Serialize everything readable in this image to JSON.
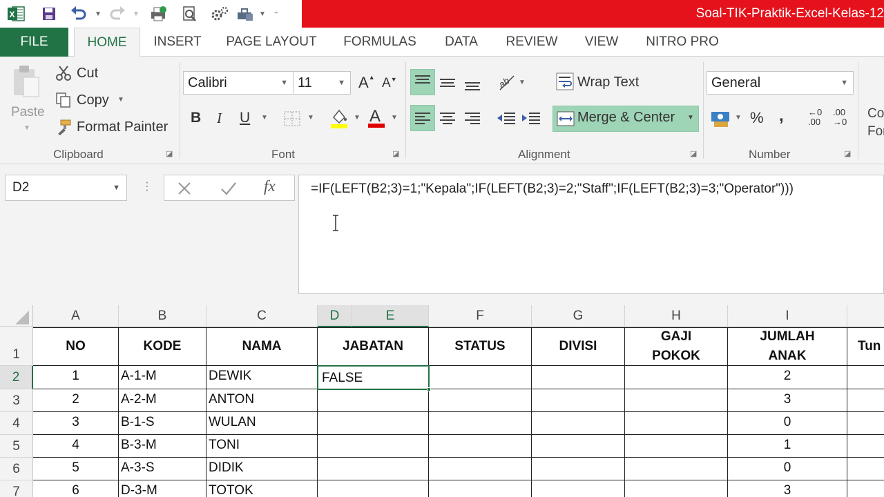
{
  "window": {
    "title": "Soal-TIK-Praktik-Excel-Kelas-12"
  },
  "tabs": [
    "FILE",
    "HOME",
    "INSERT",
    "PAGE LAYOUT",
    "FORMULAS",
    "DATA",
    "REVIEW",
    "VIEW",
    "NITRO PRO"
  ],
  "clipboard": {
    "paste": "Paste",
    "cut": "Cut",
    "copy": "Copy",
    "format_painter": "Format Painter",
    "label": "Clipboard"
  },
  "font": {
    "name": "Calibri",
    "size": "11",
    "label": "Font",
    "bold": "B",
    "italic": "I",
    "underline": "U",
    "grow": "A",
    "shrink": "A",
    "color_letter": "A"
  },
  "alignment": {
    "wrap_text": "Wrap Text",
    "merge_center": "Merge & Center",
    "label": "Alignment"
  },
  "number": {
    "format": "General",
    "percent": "%",
    "comma": ",",
    "label": "Number",
    "inc_decimal_top": "←0",
    "inc_decimal_bottom": ".00",
    "dec_decimal_top": ".00",
    "dec_decimal_bottom": "→0"
  },
  "styles": {
    "line1": "Co",
    "line2": "For"
  },
  "formula_bar": {
    "name_box": "D2",
    "fx": "fx",
    "formula": "=IF(LEFT(B2;3)=1;\"Kepala\";IF(LEFT(B2;3)=2;\"Staff\";IF(LEFT(B2;3)=3;\"Operator\")))"
  },
  "grid": {
    "columns": [
      "A",
      "B",
      "C",
      "D",
      "E",
      "F",
      "G",
      "H",
      "I"
    ],
    "rows": [
      "1",
      "2",
      "3",
      "4",
      "5",
      "6",
      "7"
    ],
    "headers": {
      "no": "NO",
      "kode": "KODE",
      "nama": "NAMA",
      "jabatan": "JABATAN",
      "status": "STATUS",
      "divisi": "DIVISI",
      "gaji": "GAJI POKOK",
      "jumlah": "JUMLAH ANAK",
      "tun": "Tun"
    },
    "data": [
      {
        "no": "1",
        "kode": "A-1-M",
        "nama": "DEWIK",
        "jabatan": "FALSE",
        "anak": "2"
      },
      {
        "no": "2",
        "kode": "A-2-M",
        "nama": "ANTON",
        "jabatan": "",
        "anak": "3"
      },
      {
        "no": "3",
        "kode": "B-1-S",
        "nama": "WULAN",
        "jabatan": "",
        "anak": "0"
      },
      {
        "no": "4",
        "kode": "B-3-M",
        "nama": "TONI",
        "jabatan": "",
        "anak": "1"
      },
      {
        "no": "5",
        "kode": "A-3-S",
        "nama": "DIDIK",
        "jabatan": "",
        "anak": "0"
      },
      {
        "no": "6",
        "kode": "D-3-M",
        "nama": "TOTOK",
        "jabatan": "",
        "anak": "3"
      }
    ]
  },
  "colors": {
    "excel_green": "#217346",
    "title_red": "#e5121b"
  }
}
